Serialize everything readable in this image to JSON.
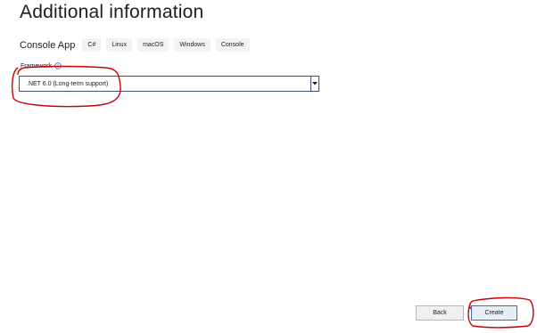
{
  "page": {
    "title": "Additional information"
  },
  "template": {
    "name": "Console App",
    "tags": [
      "C#",
      "Linux",
      "macOS",
      "Windows",
      "Console"
    ]
  },
  "framework": {
    "label": "Framework",
    "info_icon": "info-icon",
    "selected": ".NET 6.0 (Long-term support)",
    "arrow_icon": "chevron-down-icon"
  },
  "buttons": {
    "back": "Back",
    "create": "Create"
  },
  "colors": {
    "annotation": "#cc0000",
    "accent": "#3b6fb6",
    "info": "#1a6fc0"
  }
}
